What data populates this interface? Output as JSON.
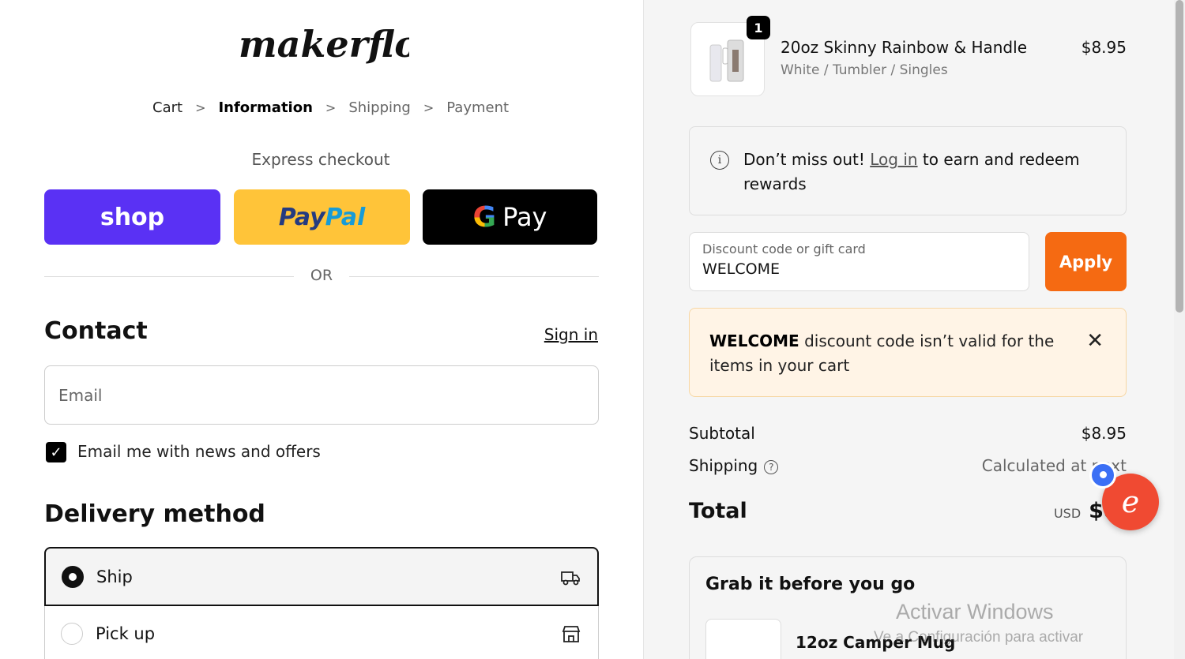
{
  "brand": {
    "logo_text": "makerflo"
  },
  "breadcrumb": {
    "cart": "Cart",
    "information": "Information",
    "shipping": "Shipping",
    "payment": "Payment",
    "separator": ">"
  },
  "express": {
    "label": "Express checkout",
    "shop": "shop",
    "paypal_part1": "Pay",
    "paypal_part2": "Pal",
    "gpay_g": "G",
    "gpay_text": "Pay",
    "or": "OR"
  },
  "contact": {
    "title": "Contact",
    "sign_in": "Sign in",
    "email_placeholder": "Email",
    "email_value": "",
    "newsletter_label": "Email me with news and offers",
    "newsletter_checked": true
  },
  "delivery": {
    "title": "Delivery method",
    "options": [
      {
        "label": "Ship",
        "selected": true,
        "icon": "truck-icon"
      },
      {
        "label": "Pick up",
        "selected": false,
        "icon": "store-icon"
      }
    ]
  },
  "order": {
    "item": {
      "quantity": "1",
      "name": "20oz Skinny Rainbow & Handle",
      "variant": "White / Tumbler / Singles",
      "price": "$8.95"
    },
    "rewards": {
      "prefix": "Don’t miss out! ",
      "link": "Log in",
      "suffix": " to earn and redeem rewards"
    },
    "discount": {
      "placeholder": "Discount code or gift card",
      "value": "WELCOME",
      "apply": "Apply"
    },
    "error": {
      "code": "WELCOME",
      "message": " discount code isn’t valid for the items in your cart"
    },
    "subtotal_label": "Subtotal",
    "subtotal_value": "$8.95",
    "shipping_label": "Shipping",
    "shipping_value": "Calculated at next",
    "total_label": "Total",
    "total_currency": "USD",
    "total_value": "$8."
  },
  "upsell": {
    "title": "Grab it before you go",
    "item_name": "12oz Camper Mug"
  },
  "watermark": {
    "line1": "Activar Windows",
    "line2": "Ve a Configuración para activar"
  },
  "colors": {
    "shop": "#5a31f4",
    "paypal": "#ffc439",
    "gpay": "#000000",
    "apply": "#f56a12",
    "error_bg": "#fff4e6",
    "widget": "#f04a32"
  }
}
